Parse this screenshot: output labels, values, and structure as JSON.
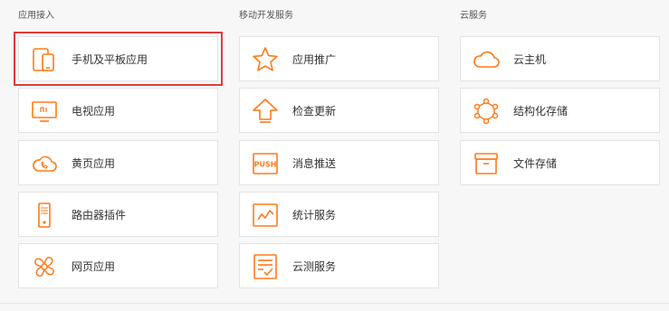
{
  "accent_color": "#ff7a1a",
  "selection_color": "#e03b3b",
  "columns": [
    {
      "title": "应用接入",
      "items": [
        {
          "label": "手机及平板应用",
          "icon": "phone-tablet-icon",
          "selected": true
        },
        {
          "label": "电视应用",
          "icon": "tv-icon"
        },
        {
          "label": "黄页应用",
          "icon": "cloud-phone-icon"
        },
        {
          "label": "路由器插件",
          "icon": "router-icon"
        },
        {
          "label": "网页应用",
          "icon": "web-icon"
        }
      ]
    },
    {
      "title": "移动开发服务",
      "items": [
        {
          "label": "应用推广",
          "icon": "star-icon"
        },
        {
          "label": "检查更新",
          "icon": "upload-arrow-icon"
        },
        {
          "label": "消息推送",
          "icon": "push-icon"
        },
        {
          "label": "统计服务",
          "icon": "stats-icon"
        },
        {
          "label": "云测服务",
          "icon": "checklist-icon"
        }
      ]
    },
    {
      "title": "云服务",
      "items": [
        {
          "label": "云主机",
          "icon": "cloud-icon"
        },
        {
          "label": "结构化存储",
          "icon": "structured-storage-icon"
        },
        {
          "label": "文件存储",
          "icon": "file-box-icon"
        }
      ]
    }
  ]
}
